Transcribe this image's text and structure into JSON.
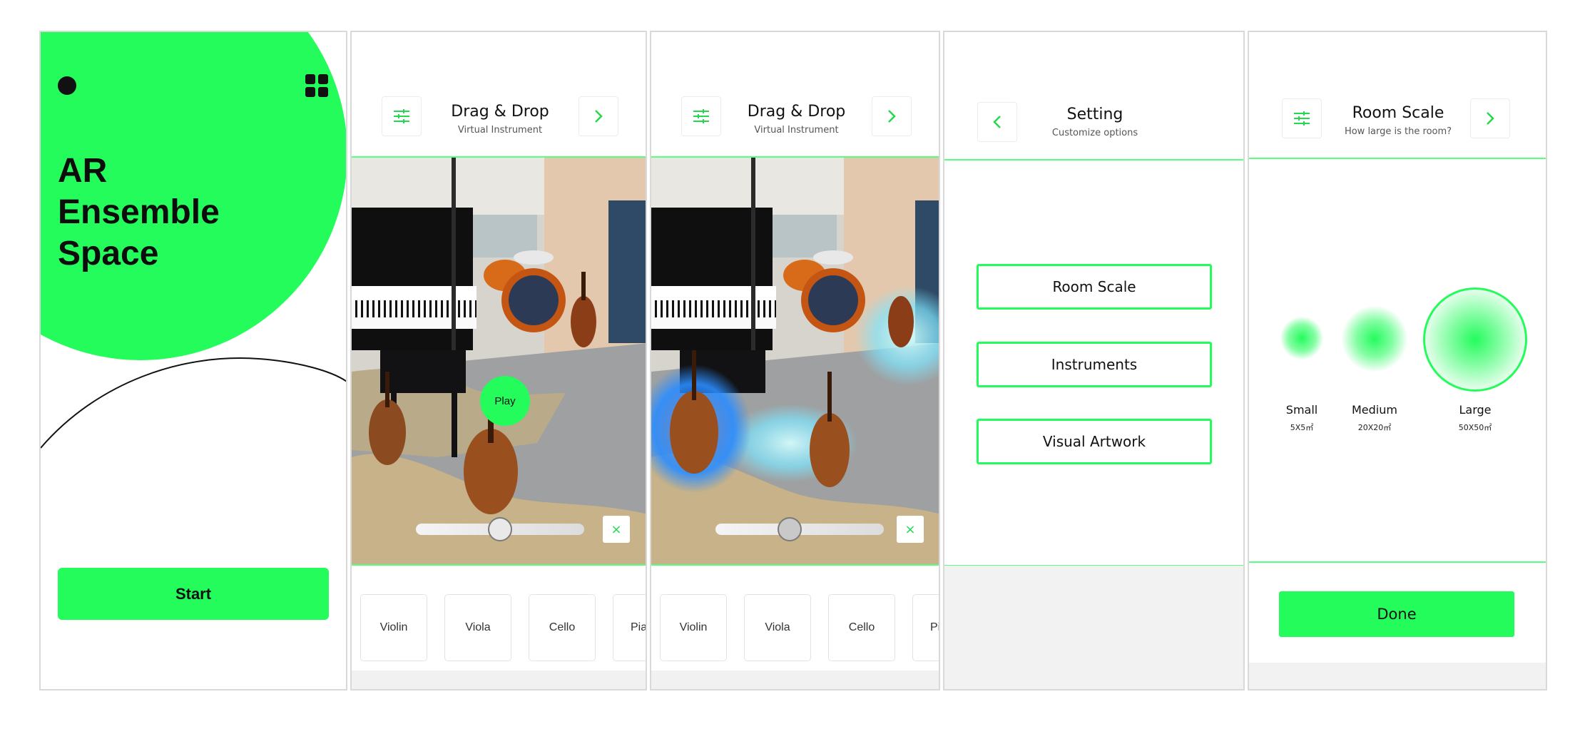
{
  "colors": {
    "accent": "#24fc5c",
    "border": "#d9d9d9"
  },
  "home": {
    "title_lines": [
      "AR",
      "Ensemble",
      "Space"
    ],
    "start_label": "Start",
    "icons": [
      "dot-icon",
      "grid-icon"
    ]
  },
  "dragdrop": {
    "title": "Drag & Drop",
    "subtitle": "Virtual Instrument",
    "play_label": "Play",
    "close_label": "×",
    "volume_level": 0.5,
    "instruments": [
      "Violin",
      "Viola",
      "Cello",
      "Piano"
    ]
  },
  "dragdrop_playing": {
    "title": "Drag & Drop",
    "subtitle": "Virtual Instrument",
    "close_label": "×",
    "volume_level": 0.44,
    "instruments": [
      "Violin",
      "Viola",
      "Cello",
      "Piano"
    ]
  },
  "setting": {
    "title": "Setting",
    "subtitle": "Customize options",
    "options": [
      "Room Scale",
      "Instruments",
      "Visual Artwork"
    ]
  },
  "room_scale": {
    "title": "Room Scale",
    "subtitle": "How large is the room?",
    "sizes": [
      {
        "label": "Small",
        "dim": "5X5㎡"
      },
      {
        "label": "Medium",
        "dim": "20X20㎡"
      },
      {
        "label": "Large",
        "dim": "50X50㎡"
      }
    ],
    "selected": "Large",
    "done_label": "Done"
  }
}
